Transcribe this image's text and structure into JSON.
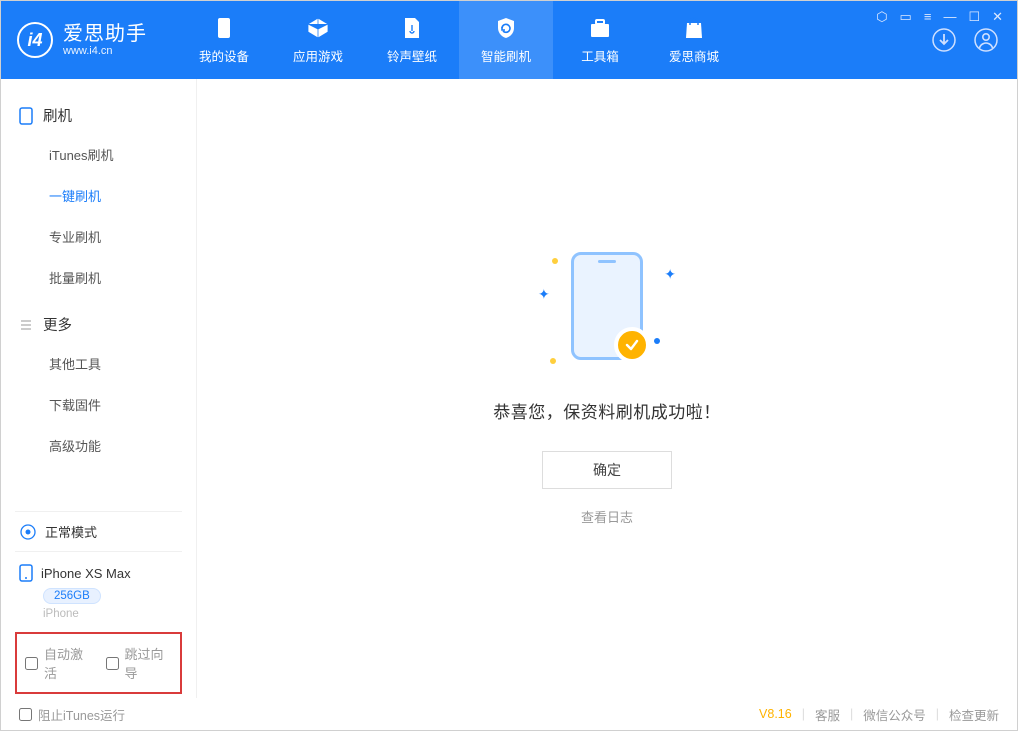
{
  "app": {
    "name": "爱思助手",
    "url": "www.i4.cn"
  },
  "tabs": [
    {
      "label": "我的设备"
    },
    {
      "label": "应用游戏"
    },
    {
      "label": "铃声壁纸"
    },
    {
      "label": "智能刷机"
    },
    {
      "label": "工具箱"
    },
    {
      "label": "爱思商城"
    }
  ],
  "sidebar": {
    "section1": "刷机",
    "items1": [
      {
        "label": "iTunes刷机"
      },
      {
        "label": "一键刷机"
      },
      {
        "label": "专业刷机"
      },
      {
        "label": "批量刷机"
      }
    ],
    "section2": "更多",
    "items2": [
      {
        "label": "其他工具"
      },
      {
        "label": "下载固件"
      },
      {
        "label": "高级功能"
      }
    ],
    "mode": "正常模式",
    "device_name": "iPhone XS Max",
    "device_capacity": "256GB",
    "device_type": "iPhone",
    "checkbox1": "自动激活",
    "checkbox2": "跳过向导"
  },
  "main": {
    "success_text": "恭喜您，保资料刷机成功啦！",
    "ok_button": "确定",
    "view_log": "查看日志"
  },
  "footer": {
    "block_itunes": "阻止iTunes运行",
    "version": "V8.16",
    "service": "客服",
    "wechat": "微信公众号",
    "update": "检查更新"
  }
}
